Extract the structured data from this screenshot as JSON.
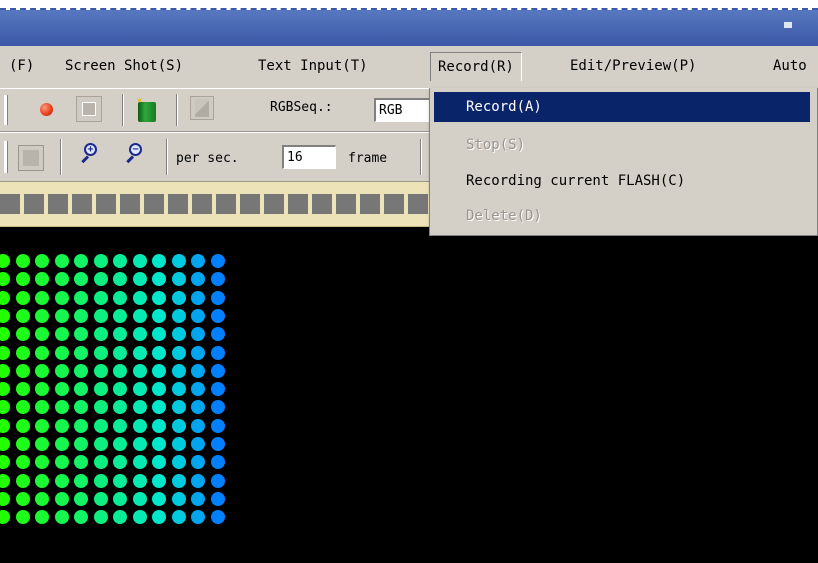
{
  "menubar": {
    "items": [
      {
        "label": "(F)"
      },
      {
        "label": "Screen Shot(S)"
      },
      {
        "label": "Text Input(T)"
      },
      {
        "label": "Record(R)"
      },
      {
        "label": "Edit/Preview(P)"
      },
      {
        "label": "Auto"
      }
    ]
  },
  "record_menu": {
    "items": [
      {
        "label": "Record(A)",
        "state": "highlighted"
      },
      {
        "label": "Stop(S)",
        "state": "disabled"
      },
      {
        "label": "Recording current FLASH(C)",
        "state": "enabled"
      },
      {
        "label": "Delete(D)",
        "state": "disabled"
      }
    ]
  },
  "toolbar1": {
    "rgb_label": "RGBSeq.:",
    "rgb_value": "RGB",
    "icons": [
      "record-dot-icon",
      "stop-square-icon",
      "bin-icon",
      "check-icon"
    ]
  },
  "toolbar2": {
    "per_sec_label": "per sec.",
    "fps_value": "16",
    "frame_label": "frame",
    "icons": [
      "frame-icon",
      "zoom-in-icon",
      "zoom-out-icon"
    ]
  },
  "colors": {
    "menu_highlight": "#0a246a",
    "titlebar": "#3b58a6",
    "led_start": "#22ff00",
    "led_end": "#0080ff"
  }
}
